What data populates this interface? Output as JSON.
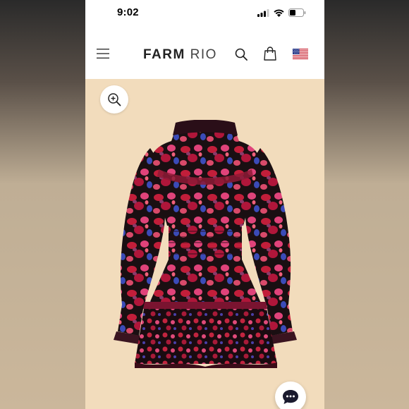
{
  "status_bar": {
    "time": "9:02",
    "icons": [
      "signal-icon",
      "wifi-icon",
      "battery-icon"
    ]
  },
  "header": {
    "brand_bold": "FARM",
    "brand_light": "RIO",
    "icons": [
      "menu-icon",
      "search-icon",
      "shopping-bag-icon",
      "us-flag-icon"
    ]
  },
  "product": {
    "icons": [
      "zoom-in-icon",
      "chat-icon"
    ]
  },
  "colors": {
    "background_panel": "#f2dcbc",
    "dress_base": "#1a0f12",
    "dress_red": "#c21e3a",
    "dress_pink": "#e0437a",
    "dress_blue": "#3b4bb8",
    "chat_button_bg": "#ffffff",
    "chat_icon": "#1a1a2e"
  }
}
